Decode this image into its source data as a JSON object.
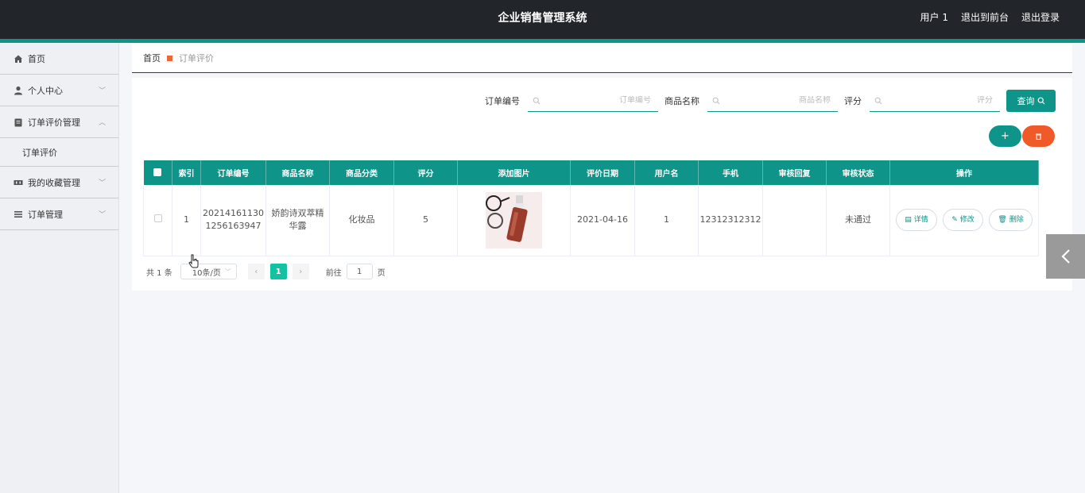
{
  "header": {
    "title": "企业销售管理系统",
    "user_label": "用户 1",
    "front_label": "退出到前台",
    "logout_label": "退出登录"
  },
  "sidebar": {
    "items": [
      {
        "label": "首页",
        "icon": "home-icon"
      },
      {
        "label": "个人中心",
        "icon": "user-icon"
      },
      {
        "label": "订单评价管理",
        "icon": "clipboard-icon",
        "expanded": true
      },
      {
        "label": "订单评价",
        "sub": true
      },
      {
        "label": "我的收藏管理",
        "icon": "collection-icon"
      },
      {
        "label": "订单管理",
        "icon": "list-icon"
      }
    ]
  },
  "breadcrumb": {
    "home": "首页",
    "current": "订单评价"
  },
  "search": {
    "order_no_label": "订单编号",
    "order_no_placeholder": "订单编号",
    "product_label": "商品名称",
    "product_placeholder": "商品名称",
    "rating_label": "评分",
    "rating_placeholder": "评分",
    "query_label": "查询"
  },
  "actions": {
    "add_label": "+"
  },
  "table": {
    "columns": [
      "索引",
      "订单编号",
      "商品名称",
      "商品分类",
      "评分",
      "添加图片",
      "评价日期",
      "用户名",
      "手机",
      "审核回复",
      "审核状态",
      "操作"
    ],
    "rows": [
      {
        "index": "1",
        "order_no_line1": "20214161130",
        "order_no_line2": "1256163947",
        "product_line1": "娇韵诗双萃精",
        "product_line2": "华露",
        "category": "化妆品",
        "rating": "5",
        "image": "cosmetic-product-photo",
        "date": "2021-04-16",
        "username": "1",
        "phone": "12312312312",
        "reply": "",
        "status": "未通过",
        "detail_label": "详情",
        "edit_label": "修改",
        "delete_label": "删除"
      }
    ]
  },
  "pagination": {
    "total_label": "共 1 条",
    "page_size": "10条/页",
    "current_page": "1",
    "goto_label": "前往",
    "goto_value": "1",
    "page_suffix": "页"
  },
  "colors": {
    "accent": "#0e9488",
    "danger": "#f05a28",
    "header_bg": "#22252a"
  }
}
